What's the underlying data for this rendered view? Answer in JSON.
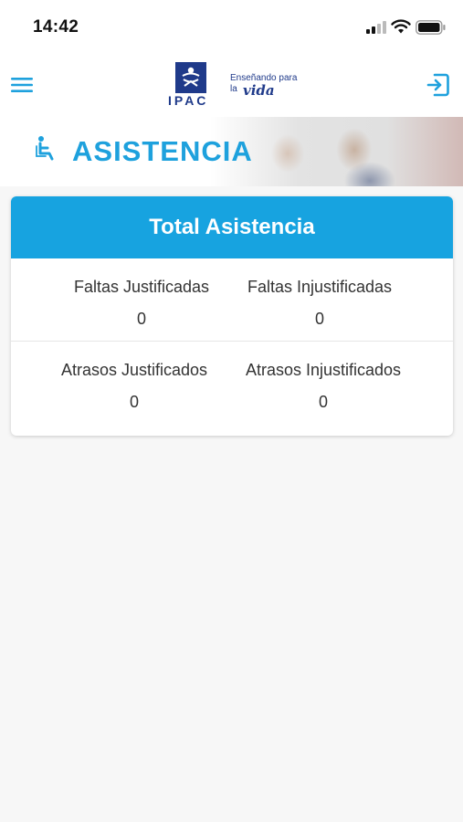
{
  "status_bar": {
    "time": "14:42"
  },
  "app_bar": {
    "logo": {
      "name": "IPAC",
      "tagline_line1": "Enseñando para",
      "tagline_line2": "la",
      "tagline_word": "vida"
    },
    "menu_icon": "hamburger-menu-icon",
    "logout_icon": "logout-icon"
  },
  "banner": {
    "title": "ASISTENCIA",
    "icon": "accessible-seat-icon"
  },
  "summary": {
    "title": "Total Asistencia",
    "rows": [
      [
        {
          "label": "Faltas Justificadas",
          "value": "0"
        },
        {
          "label": "Faltas Injustificadas",
          "value": "0"
        }
      ],
      [
        {
          "label": "Atrasos Justificados",
          "value": "0"
        },
        {
          "label": "Atrasos Injustificados",
          "value": "0"
        }
      ]
    ]
  },
  "colors": {
    "accent": "#17a3e0",
    "title": "#1ea1dd",
    "brand": "#1f3a8a"
  }
}
